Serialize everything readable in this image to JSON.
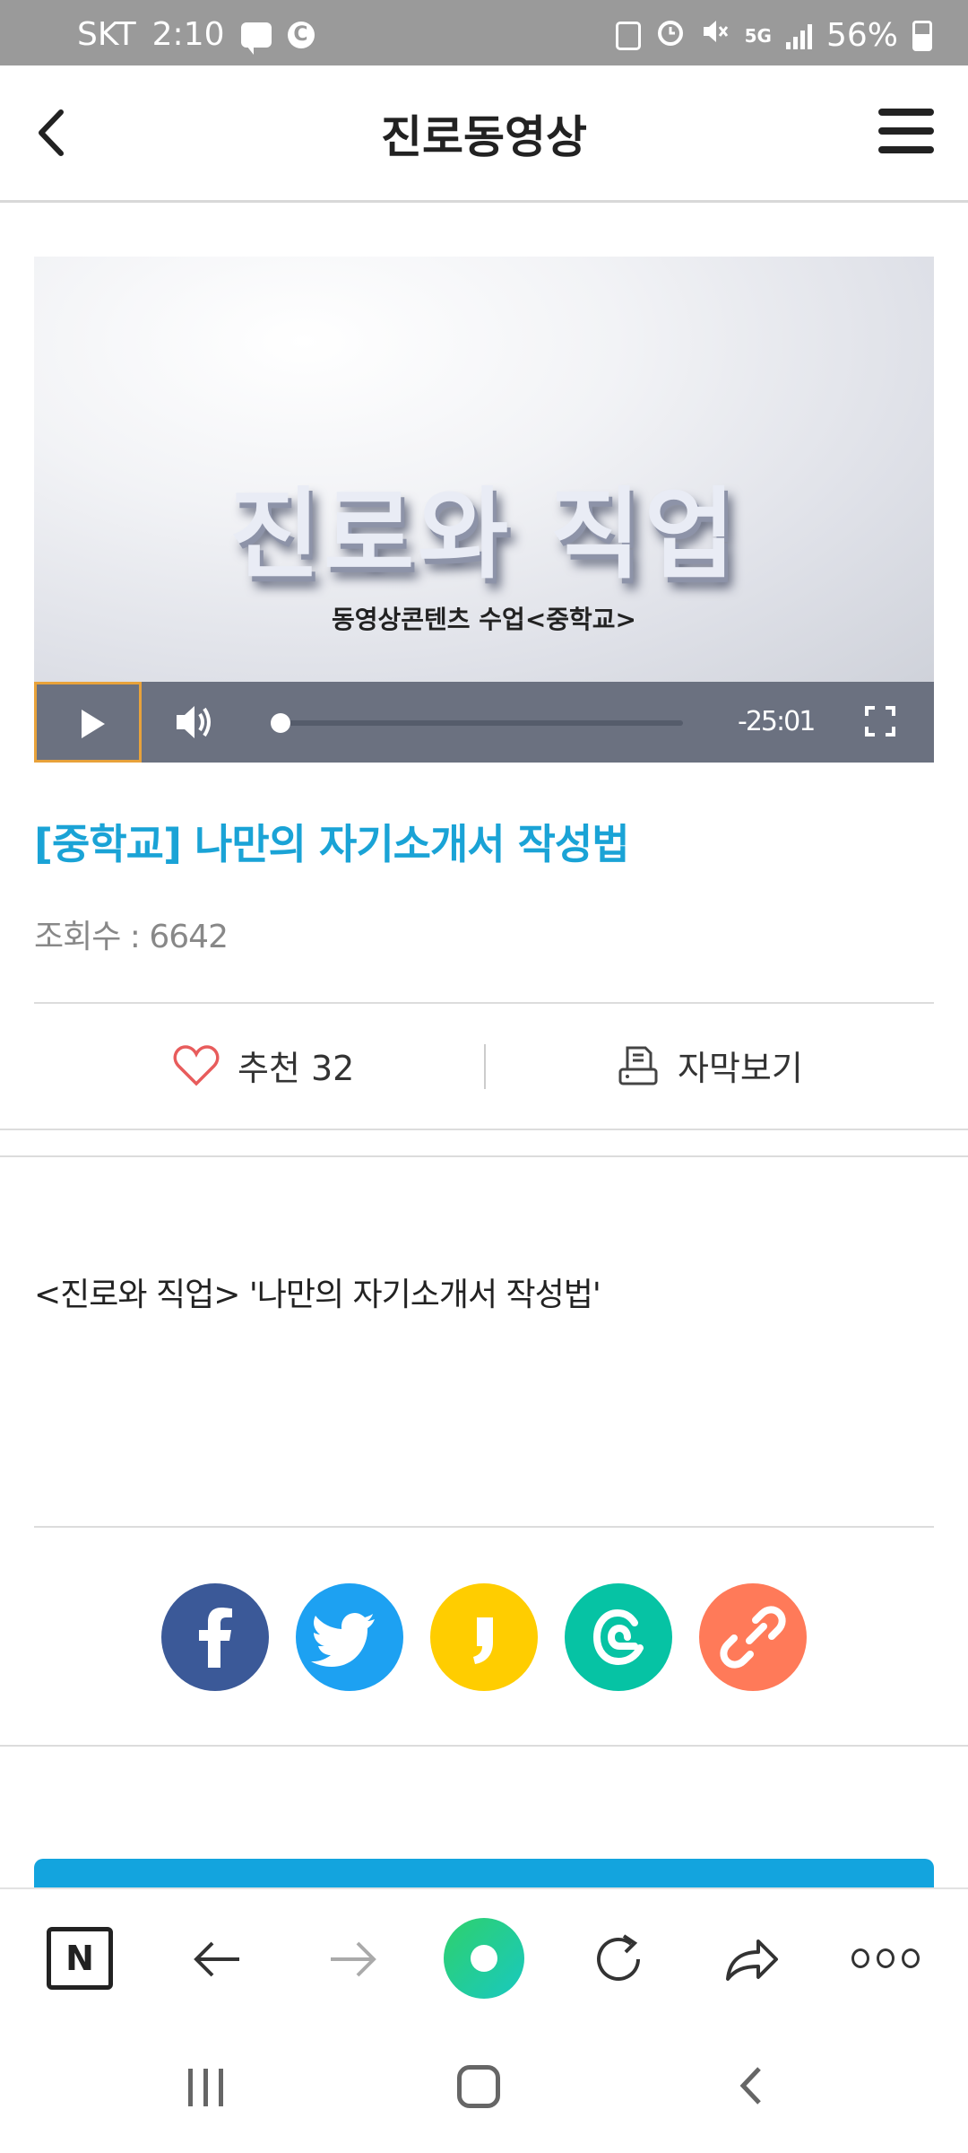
{
  "status_bar": {
    "carrier": "SKT",
    "time": "2:10",
    "network": "5G",
    "battery": "56%"
  },
  "header": {
    "title": "진로동영상"
  },
  "video": {
    "title_overlay": "진로와 직업",
    "subtitle_overlay": "동영상콘텐츠 수업<중학교>",
    "time_remaining": "-25:01",
    "progress": 0
  },
  "article": {
    "title": "[중학교] 나만의 자기소개서 작성법",
    "views_label": "조회수 : 6642",
    "like_label": "추천 32",
    "subtitle_label": "자막보기",
    "description": "<진로와 직업> '나만의 자기소개서 작성법'"
  },
  "share": {
    "items": [
      {
        "name": "facebook-share-button",
        "icon": "facebook-icon",
        "color": "#3b5998"
      },
      {
        "name": "twitter-share-button",
        "icon": "twitter-icon",
        "color": "#1da1f2"
      },
      {
        "name": "kakaostory-share-button",
        "icon": "kakaostory-icon",
        "color": "#ffcd00"
      },
      {
        "name": "band-share-button",
        "icon": "band-icon",
        "color": "#06c3a4"
      },
      {
        "name": "copy-link-button",
        "icon": "link-icon",
        "color": "#ff7a59"
      }
    ]
  },
  "browser_toolbar": {
    "n_label": "N"
  },
  "colors": {
    "accent_blue": "#1aa3d6",
    "heart_red": "#e85c5c",
    "control_bar": "#6b7180"
  }
}
